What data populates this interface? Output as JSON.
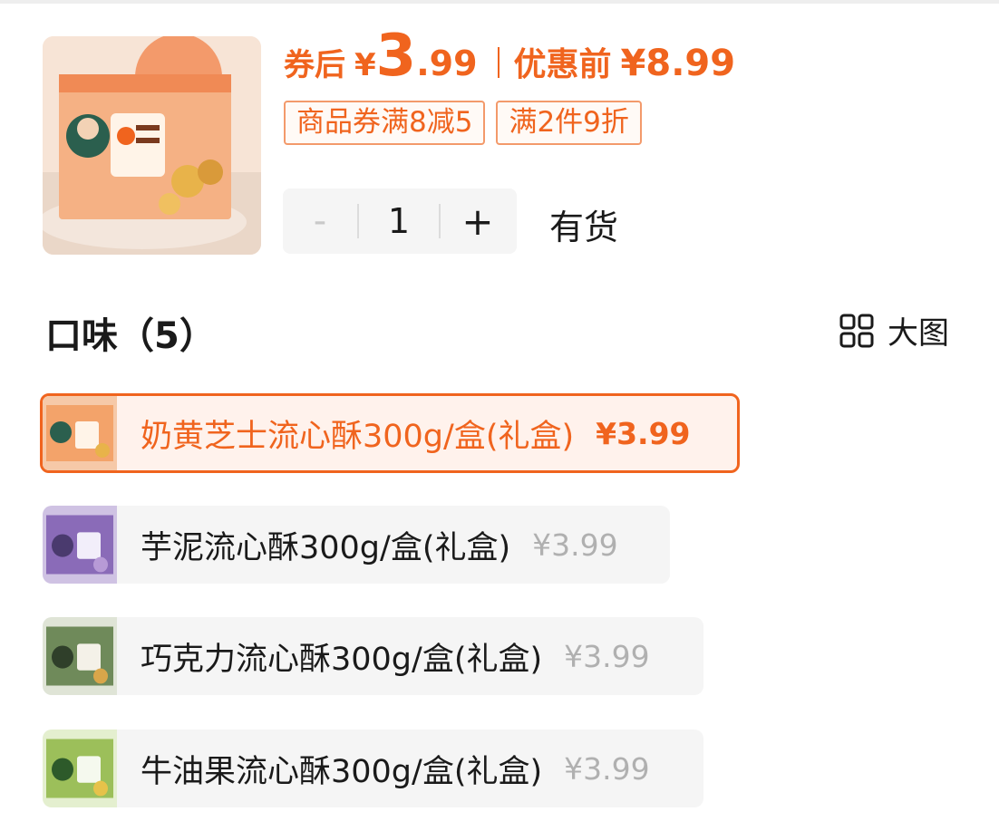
{
  "product": {
    "thumbnail_icon": "gift-box-product-image",
    "price_label": "券后",
    "currency": "¥",
    "price_int": "3",
    "price_dec": ".99",
    "original_label": "优惠前",
    "original_price": "¥8.99",
    "coupons": [
      "商品券满8减5",
      "满2件9折"
    ],
    "quantity": {
      "minus_label": "-",
      "value": "1",
      "plus_label": "+"
    },
    "stock_status": "有货"
  },
  "flavors": {
    "title": "口味（5）",
    "view_toggle_label": "大图",
    "view_toggle_icon": "grid-icon",
    "selected_index": 0,
    "options": [
      {
        "name": "奶黄芝士流心酥300g/盒(礼盒)",
        "price": "¥3.99",
        "thumb_color": "#f3a36a"
      },
      {
        "name": "芋泥流心酥300g/盒(礼盒)",
        "price": "¥3.99",
        "thumb_color": "#8a6bb8"
      },
      {
        "name": "巧克力流心酥300g/盒(礼盒)",
        "price": "¥3.99",
        "thumb_color": "#6f8a5a"
      },
      {
        "name": "牛油果流心酥300g/盒(礼盒)",
        "price": "¥3.99",
        "thumb_color": "#9cbf5a"
      }
    ]
  },
  "colors": {
    "accent": "#f0641e",
    "accent_border": "#f39a6b",
    "muted_price": "#b0b0b0",
    "option_bg": "#f5f5f5",
    "selected_bg": "#fff2ec"
  }
}
